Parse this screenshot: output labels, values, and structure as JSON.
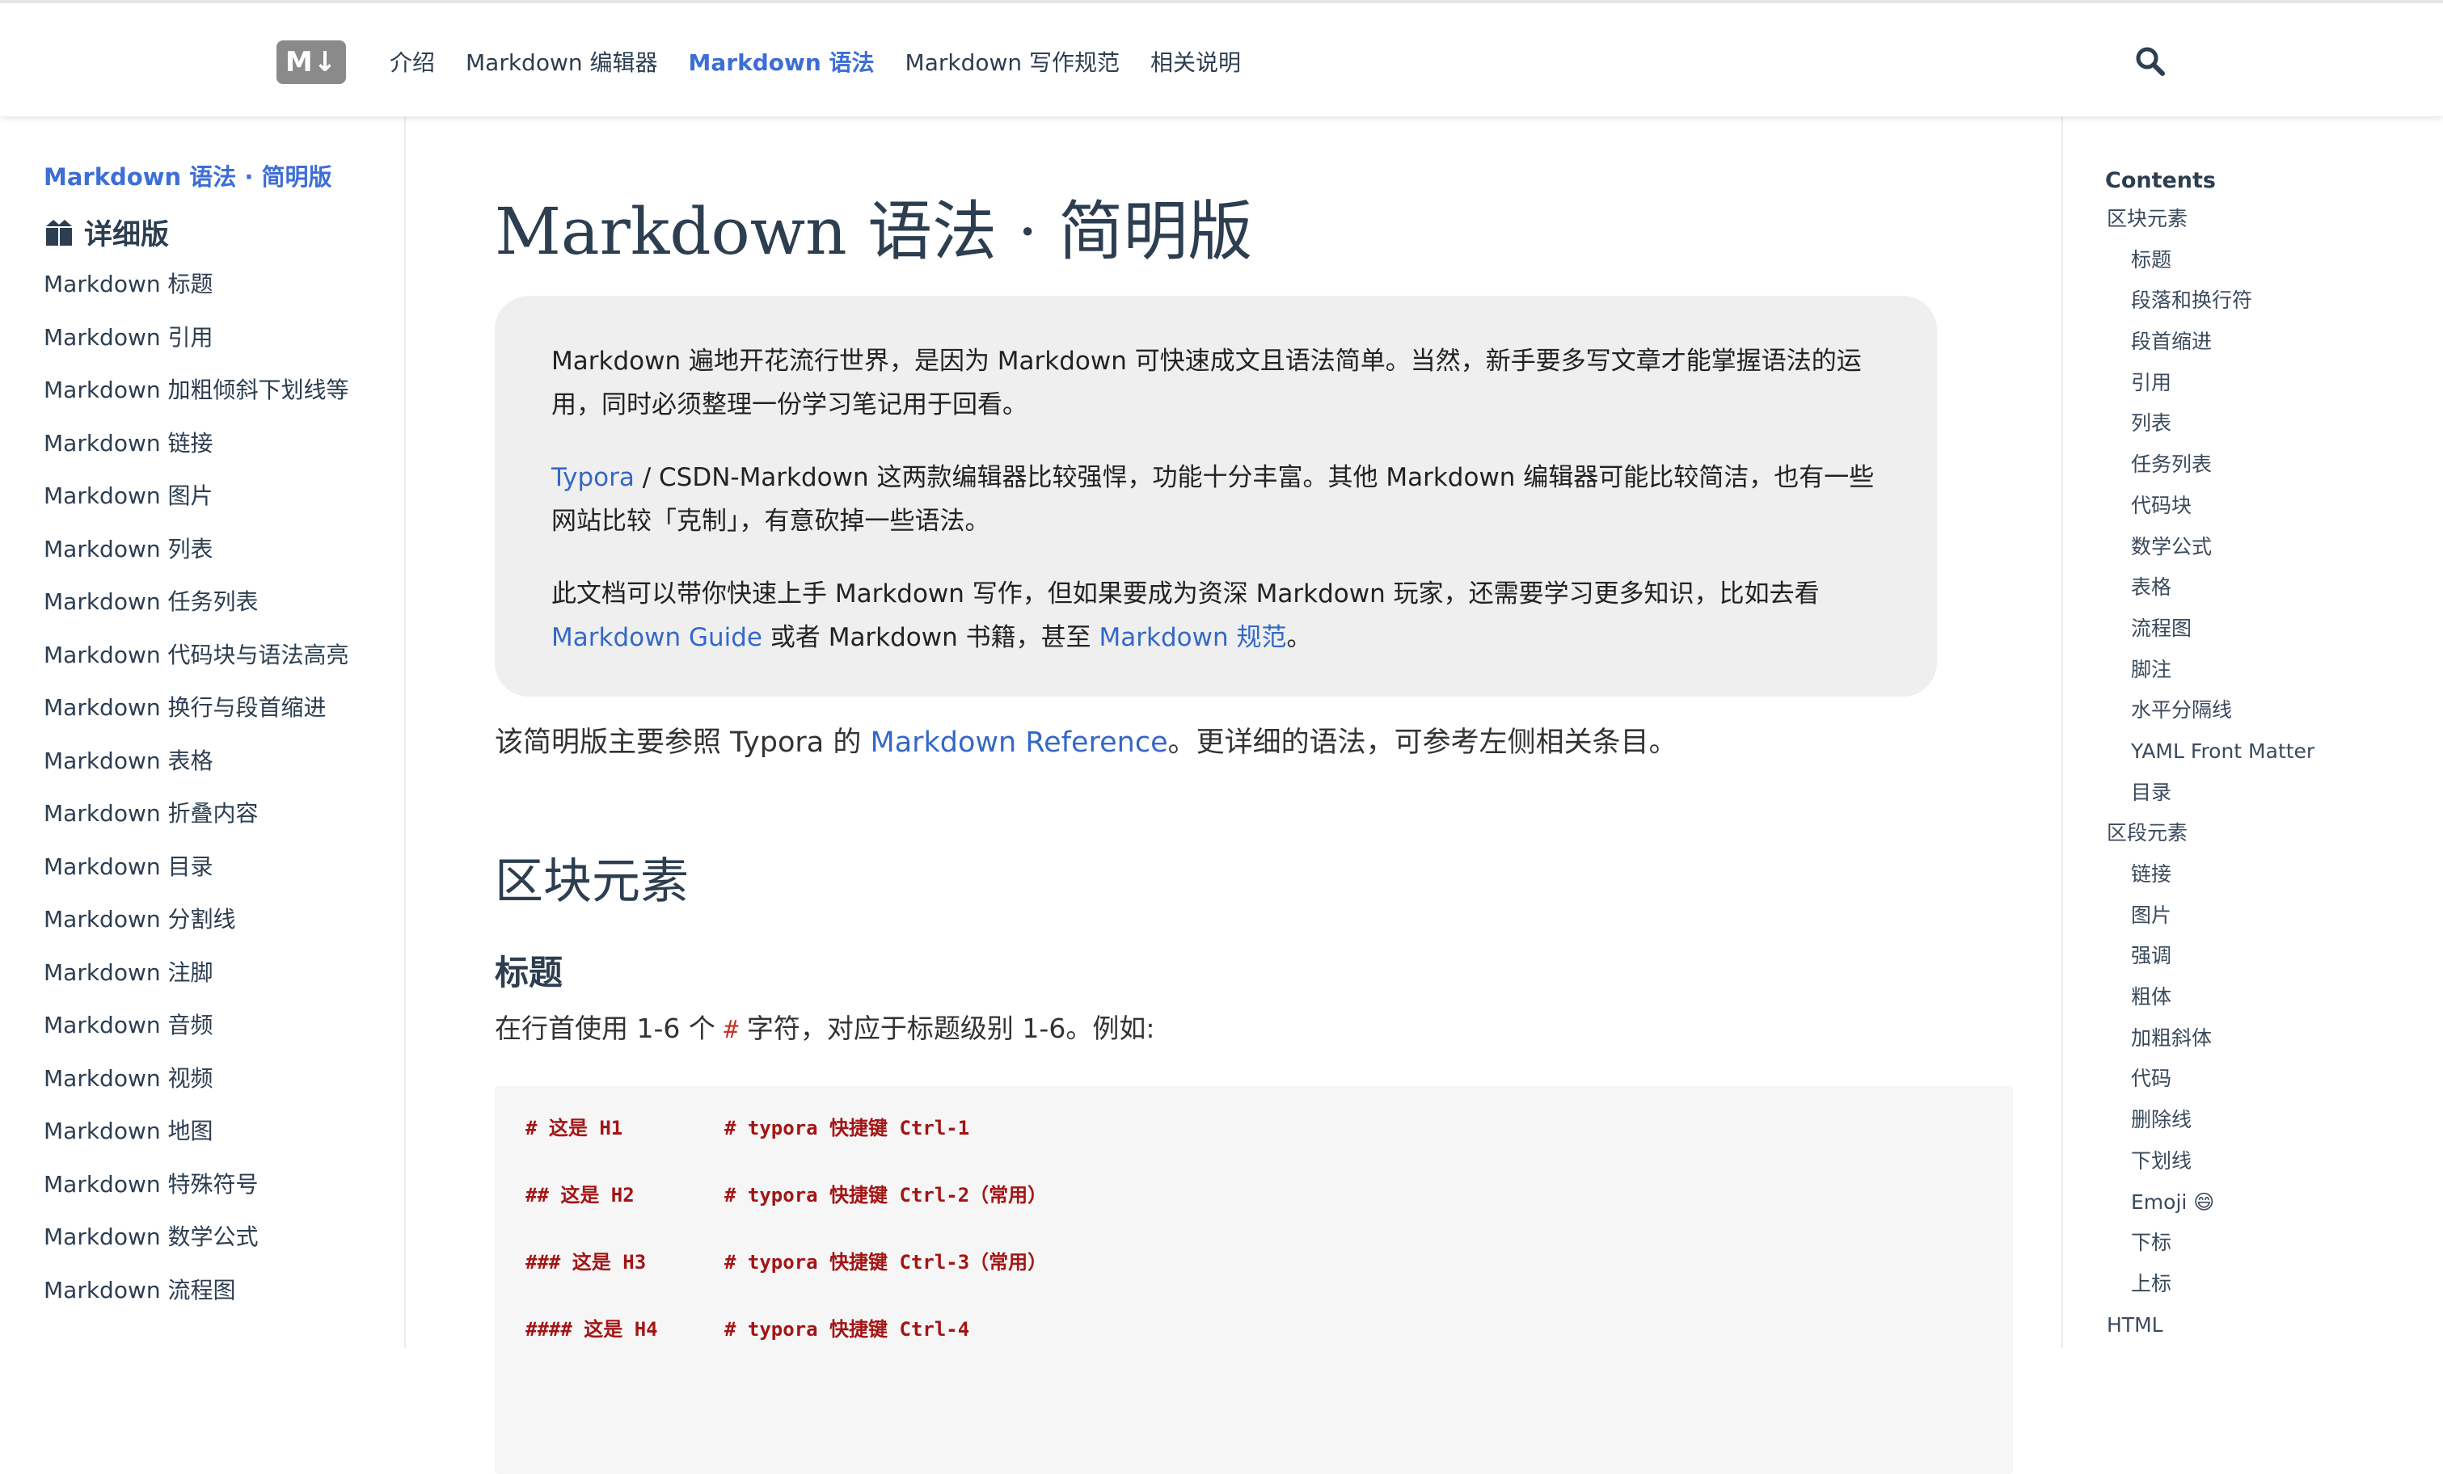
{
  "header": {
    "logo_text": "M↓",
    "nav": [
      {
        "label": "介绍"
      },
      {
        "label": "Markdown 编辑器"
      },
      {
        "label": "Markdown 语法",
        "active": true
      },
      {
        "label": "Markdown 写作规范"
      },
      {
        "label": "相关说明"
      }
    ],
    "search_icon": "search-icon"
  },
  "sidebar": {
    "title": "Markdown 语法 · 简明版",
    "group_icon": "package-icon",
    "group_label": "详细版",
    "items": [
      "Markdown 标题",
      "Markdown 引用",
      "Markdown 加粗倾斜下划线等",
      "Markdown 链接",
      "Markdown 图片",
      "Markdown 列表",
      "Markdown 任务列表",
      "Markdown 代码块与语法高亮",
      "Markdown 换行与段首缩进",
      "Markdown 表格",
      "Markdown 折叠内容",
      "Markdown 目录",
      "Markdown 分割线",
      "Markdown 注脚",
      "Markdown 音频",
      "Markdown 视频",
      "Markdown 地图",
      "Markdown 特殊符号",
      "Markdown 数学公式",
      "Markdown 流程图"
    ]
  },
  "content": {
    "title": "Markdown 语法 · 简明版",
    "intro": {
      "p1": "Markdown 遍地开花流行世界，是因为 Markdown 可快速成文且语法简单。当然，新手要多写文章才能掌握语法的运用，同时必须整理一份学习笔记用于回看。",
      "p2_link": "Typora",
      "p2_text": " / CSDN-Markdown 这两款编辑器比较强悍，功能十分丰富。其他 Markdown 编辑器可能比较简洁，也有一些网站比较「克制」，有意砍掉一些语法。",
      "p3_text1": "此文档可以带你快速上手 Markdown 写作，但如果要成为资深 Markdown 玩家，还需要学习更多知识，比如去看 ",
      "p3_link1": "Markdown Guide",
      "p3_text2": " 或者 Markdown 书籍，甚至 ",
      "p3_link2": "Markdown 规范",
      "p3_text3": "。"
    },
    "lead_text1": "该简明版主要参照 Typora 的 ",
    "lead_link": "Markdown Reference",
    "lead_text2": "。更详细的语法，可参考左侧相关条目。",
    "h2": "区块元素",
    "h3": "标题",
    "desc_text1": "在行首使用 1-6 个 ",
    "desc_code": "#",
    "desc_text2": " 字符，对应于标题级别 1-6。例如:",
    "code_lines": [
      {
        "code": "# 这是 H1",
        "comment": "# typora 快捷键 Ctrl-1"
      },
      {
        "code": "## 这是 H2",
        "comment": "# typora 快捷键 Ctrl-2（常用）"
      },
      {
        "code": "### 这是 H3",
        "comment": "# typora 快捷键 Ctrl-3（常用）"
      },
      {
        "code": "#### 这是 H4",
        "comment": "# typora 快捷键 Ctrl-4"
      }
    ]
  },
  "toc": {
    "title": "Contents",
    "items": [
      {
        "label": "区块元素",
        "level": 1
      },
      {
        "label": "标题",
        "level": 2
      },
      {
        "label": "段落和换行符",
        "level": 2
      },
      {
        "label": "段首缩进",
        "level": 2
      },
      {
        "label": "引用",
        "level": 2
      },
      {
        "label": "列表",
        "level": 2
      },
      {
        "label": "任务列表",
        "level": 2
      },
      {
        "label": "代码块",
        "level": 2
      },
      {
        "label": "数学公式",
        "level": 2
      },
      {
        "label": "表格",
        "level": 2
      },
      {
        "label": "流程图",
        "level": 2
      },
      {
        "label": "脚注",
        "level": 2
      },
      {
        "label": "水平分隔线",
        "level": 2
      },
      {
        "label": "YAML Front Matter",
        "level": 2
      },
      {
        "label": "目录",
        "level": 2
      },
      {
        "label": "区段元素",
        "level": 1
      },
      {
        "label": "链接",
        "level": 2
      },
      {
        "label": "图片",
        "level": 2
      },
      {
        "label": "强调",
        "level": 2
      },
      {
        "label": "粗体",
        "level": 2
      },
      {
        "label": "加粗斜体",
        "level": 2
      },
      {
        "label": "代码",
        "level": 2
      },
      {
        "label": "删除线",
        "level": 2
      },
      {
        "label": "下划线",
        "level": 2
      },
      {
        "label": "Emoji 😄",
        "level": 2
      },
      {
        "label": "下标",
        "level": 2
      },
      {
        "label": "上标",
        "level": 2
      },
      {
        "label": "HTML",
        "level": 1
      }
    ]
  },
  "colors": {
    "accent": "#3d6ed6",
    "link": "#3468c7",
    "code_text": "#a31515",
    "intro_bg": "#efefef"
  }
}
